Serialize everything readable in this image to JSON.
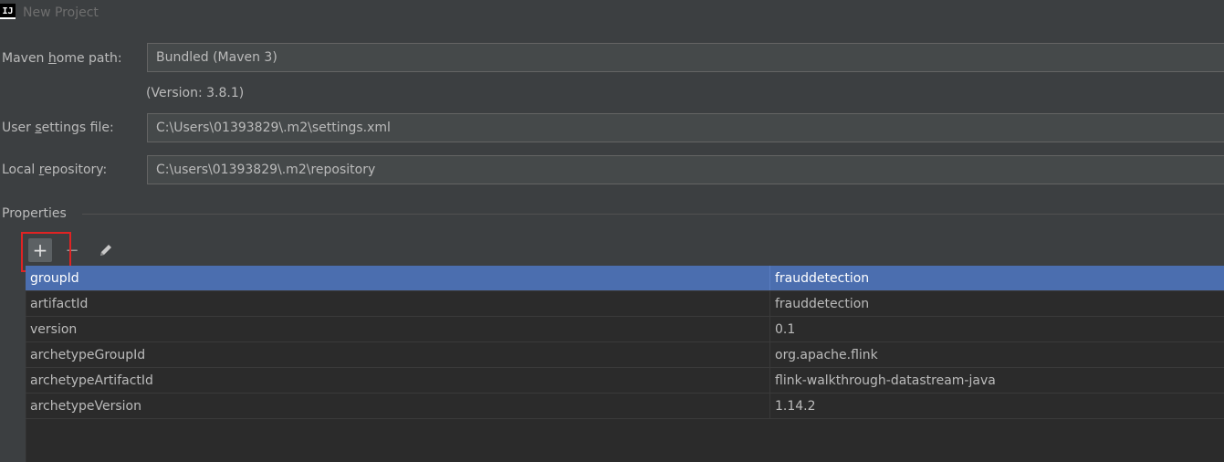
{
  "window": {
    "title": "New Project",
    "logo_text": "IJ"
  },
  "maven": {
    "home_label_pre": "Maven ",
    "home_label_mnemonic": "h",
    "home_label_post": "ome path:",
    "home_value": "Bundled (Maven 3)",
    "version_text": "(Version: 3.8.1)",
    "settings_label_pre": "User ",
    "settings_label_mnemonic": "s",
    "settings_label_post": "ettings file:",
    "settings_value": "C:\\Users\\01393829\\.m2\\settings.xml",
    "repo_label_pre": "Local ",
    "repo_label_mnemonic": "r",
    "repo_label_post": "epository:",
    "repo_value": "C:\\users\\01393829\\.m2\\repository"
  },
  "properties": {
    "section_title": "Properties",
    "toolbar": {
      "add_icon": "+",
      "remove_icon": "−",
      "edit_icon": "pencil-icon"
    },
    "rows": [
      {
        "key": "groupId",
        "value": "frauddetection",
        "selected": true
      },
      {
        "key": "artifactId",
        "value": "frauddetection",
        "selected": false
      },
      {
        "key": "version",
        "value": "0.1",
        "selected": false
      },
      {
        "key": "archetypeGroupId",
        "value": "org.apache.flink",
        "selected": false
      },
      {
        "key": "archetypeArtifactId",
        "value": "flink-walkthrough-datastream-java",
        "selected": false
      },
      {
        "key": "archetypeVersion",
        "value": "1.14.2",
        "selected": false
      }
    ]
  },
  "colors": {
    "background": "#3c3f41",
    "selection": "#4b6eaf",
    "highlight": "#e02323"
  }
}
